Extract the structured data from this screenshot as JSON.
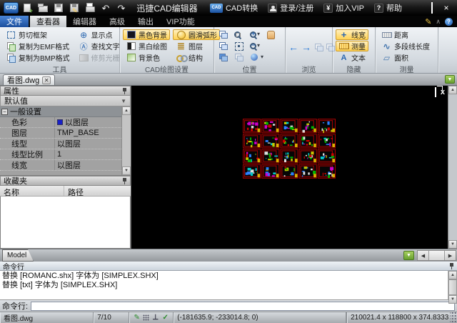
{
  "titlebar": {
    "logo": "CAD",
    "title": "迅捷CAD编辑器",
    "actions": {
      "convert": "CAD转换",
      "login": "登录/注册",
      "vip": "加入VIP",
      "help": "帮助"
    }
  },
  "menu_tabs": {
    "file": "文件",
    "viewer": "查看器",
    "editor": "编辑器",
    "advanced": "高级",
    "output": "输出",
    "vip": "VIP功能",
    "active": "查看器"
  },
  "ribbon": {
    "tools": {
      "label": "工具",
      "b1": "剪切框架",
      "b2": "复制为EMF格式",
      "b3": "复制为BMP格式",
      "b4": "显示点",
      "b5": "查找文字",
      "b6": "修剪光栅"
    },
    "cad_settings": {
      "label": "CAD绘图设置",
      "b1": "黑色背景",
      "b2": "黑白绘图",
      "b3": "背景色",
      "b4": "圆滑弧形",
      "b5": "图层",
      "b6": "结构"
    },
    "position": {
      "label": "位置"
    },
    "browse": {
      "label": "浏览"
    },
    "hide": {
      "label": "隐藏",
      "b1": "线宽",
      "b2": "测量",
      "b3": "文本"
    },
    "measure": {
      "label": "测量",
      "b1": "距离",
      "b2": "多段线长度",
      "b3": "面积"
    }
  },
  "document_tab": {
    "title": "看图.dwg"
  },
  "properties": {
    "title": "属性",
    "preset": "默认值",
    "category": "一般设置",
    "rows": [
      {
        "name": "色彩",
        "value": "以图层",
        "swatch": "#1820c8"
      },
      {
        "name": "图层",
        "value": "TMP_BASE"
      },
      {
        "name": "线型",
        "value": "以图层"
      },
      {
        "name": "线型比例",
        "value": "1"
      },
      {
        "name": "线宽",
        "value": "以图层"
      }
    ]
  },
  "favorites": {
    "title": "收藏夹",
    "col_name": "名称",
    "col_path": "路径"
  },
  "canvas": {
    "model_tab": "Model",
    "drawing": {
      "rows": 4,
      "cols": 5,
      "seed": 11,
      "palette": [
        "#00b400",
        "#00c8c8",
        "#cc00cc",
        "#c8c800",
        "#d00000",
        "#e0e0e0",
        "#2a7fff"
      ],
      "frame": "#a80000",
      "accent": "#d8b400"
    }
  },
  "command_panel": {
    "title": "命令行",
    "lines": [
      "替换 [ROMANC.shx] 字体为 [SIMPLEX.SHX]",
      "替换 [txt] 字体为 [SIMPLEX.SHX]"
    ]
  },
  "command_input": {
    "label": "命令行:",
    "value": ""
  },
  "statusbar": {
    "file": "看图.dwg",
    "page": "7/10",
    "coords": "(-181635.9; -233014.8; 0)",
    "dims": "210021.4 x 118800 x 374.8333"
  },
  "icons": {
    "window": [
      "minimize-icon",
      "maximize-icon",
      "close-icon"
    ],
    "quick_access": [
      "new-file-icon",
      "open-folder-icon",
      "save-icon",
      "save-as-icon",
      "print-icon",
      "undo-icon",
      "redo-icon"
    ],
    "status": [
      "draft-mode-icon",
      "grid-snap-icon",
      "ortho-icon",
      "osnap-icon"
    ]
  }
}
